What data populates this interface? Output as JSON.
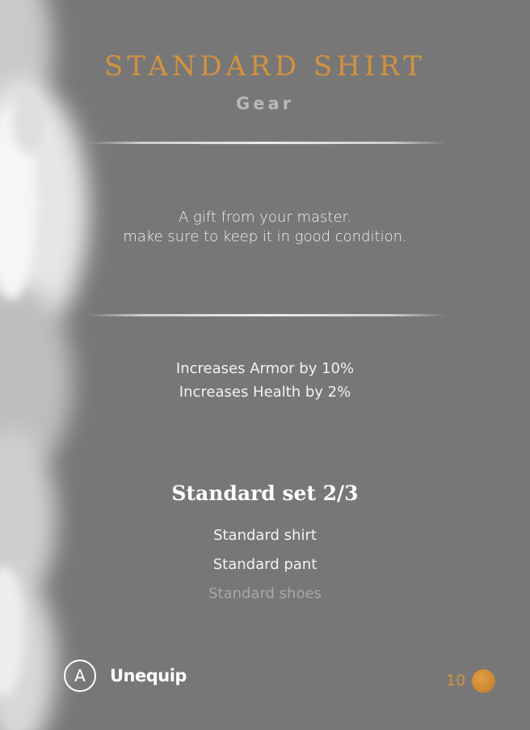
{
  "item": {
    "name": "STANDARD SHIRT",
    "category": "Gear",
    "description_lines": [
      "A gift from your master.",
      "make sure to keep it in good condition."
    ],
    "stats": [
      "Increases Armor by 10%",
      "Increases Health by 2%"
    ]
  },
  "set": {
    "title": "Standard set 2/3",
    "items": [
      {
        "label": "Standard shirt",
        "owned": true
      },
      {
        "label": "Standard pant",
        "owned": true
      },
      {
        "label": "Standard shoes",
        "owned": false
      }
    ]
  },
  "actions": {
    "unequip_button": "A",
    "unequip_label": "Unequip"
  },
  "price": {
    "value": "10",
    "currency_icon": "coin-icon"
  },
  "colors": {
    "background": "#777777",
    "accent": "#d4923e",
    "text_primary": "#f2f2f2",
    "text_muted": "#a8a8a8"
  }
}
